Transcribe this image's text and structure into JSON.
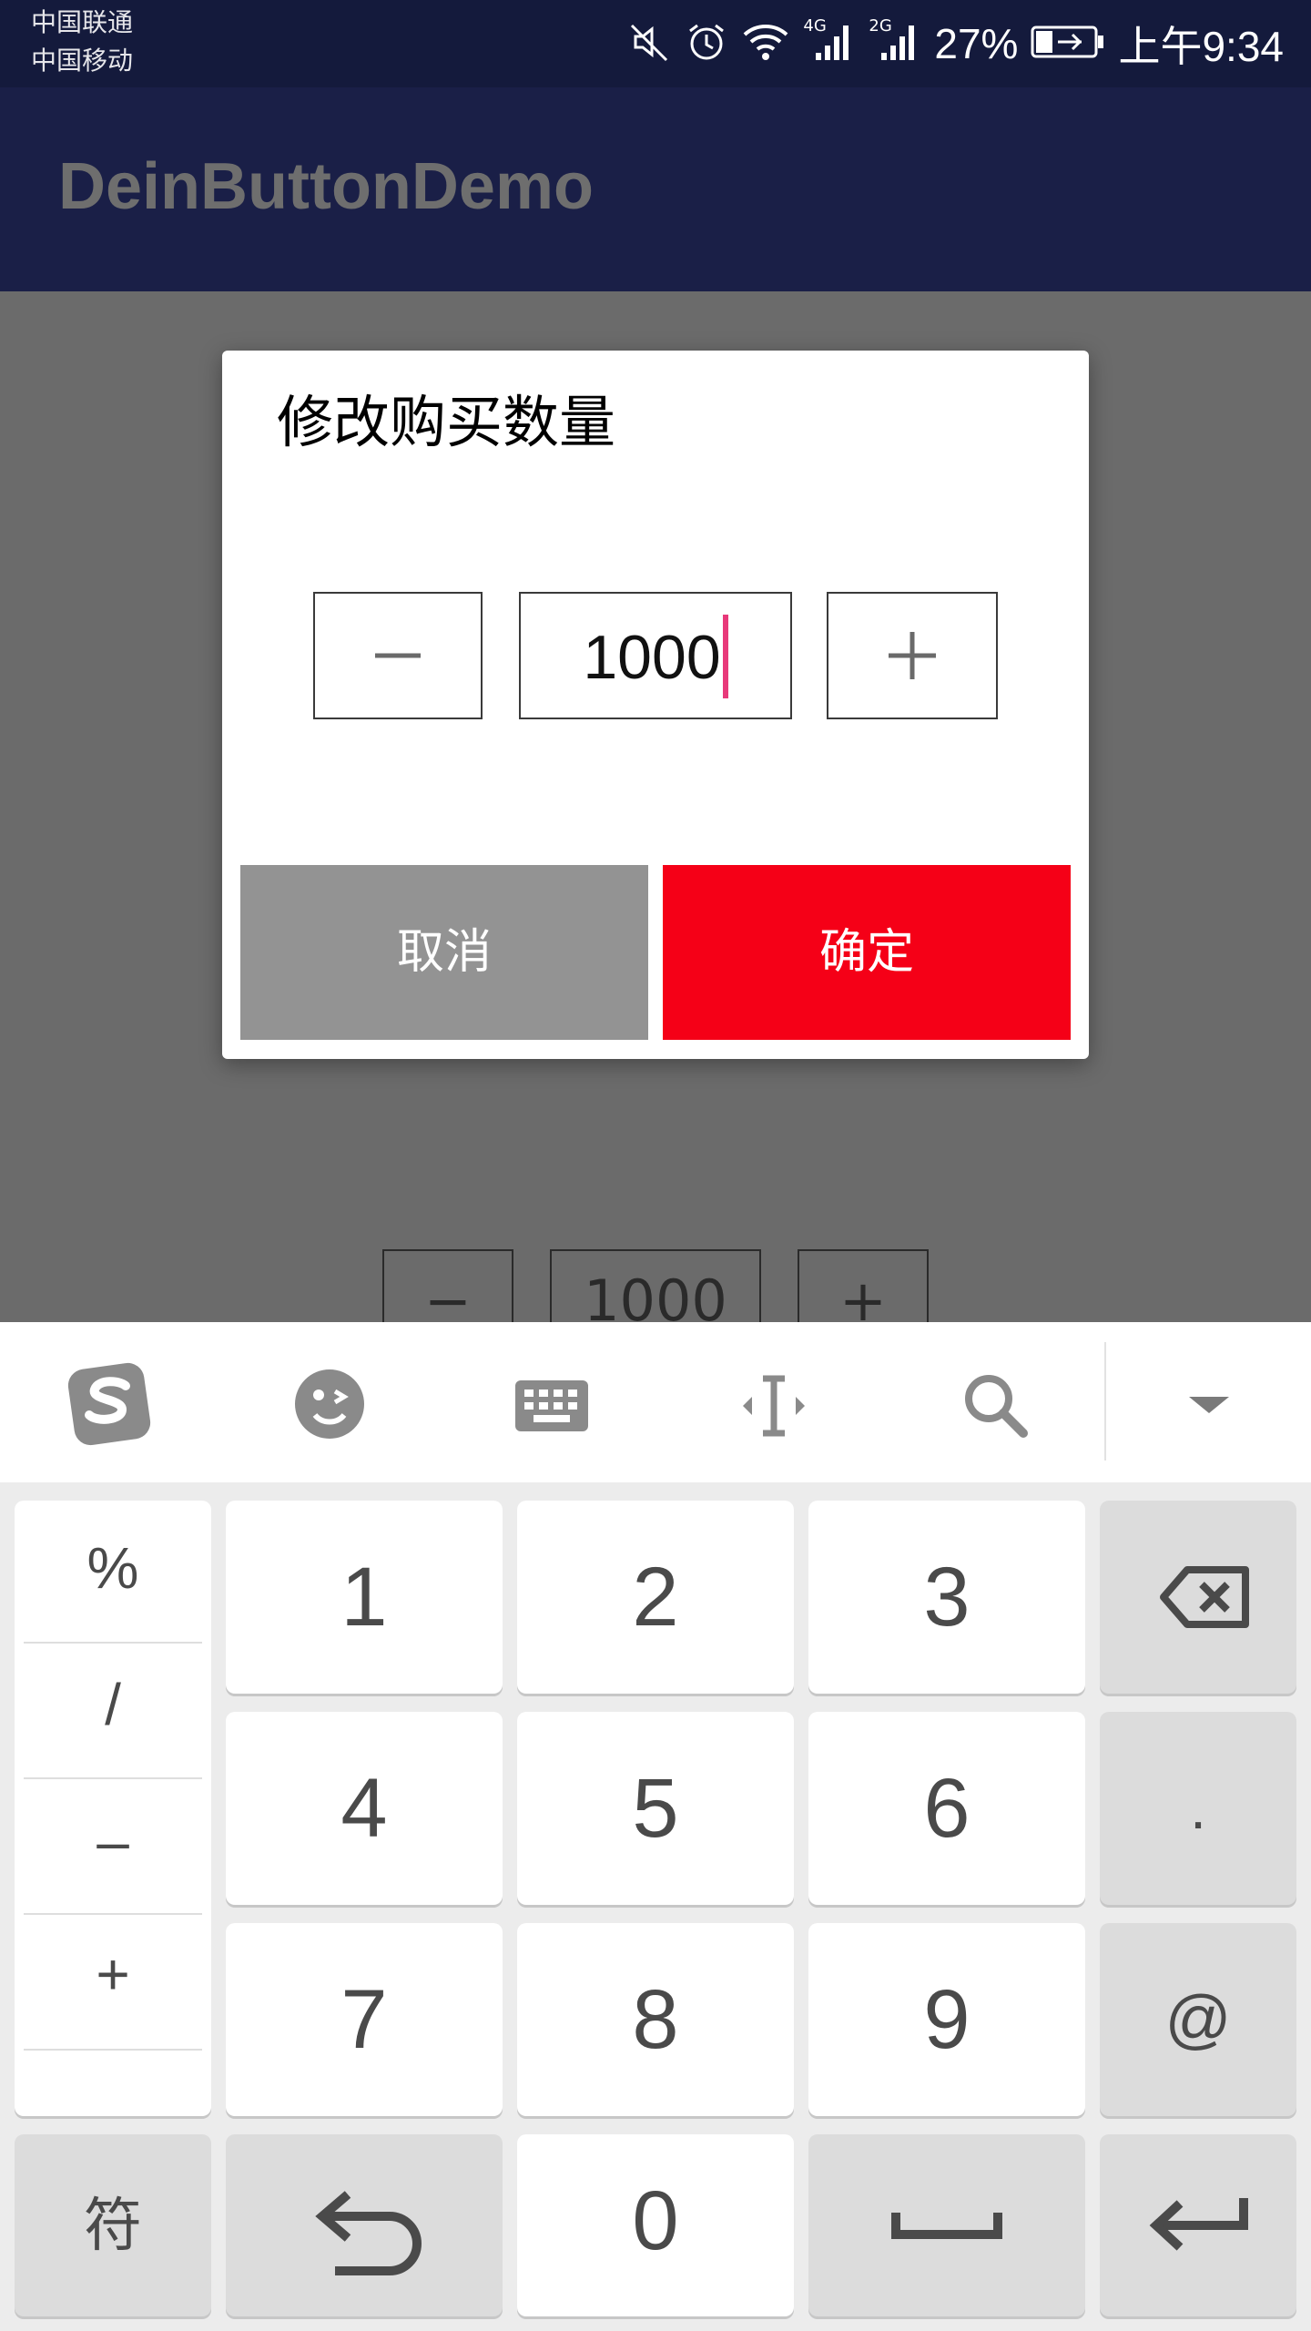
{
  "status_bar": {
    "carrier1": "中国联通",
    "carrier2": "中国移动",
    "net1": "4G",
    "net2": "2G",
    "battery": "27%",
    "time": "上午9:34",
    "icons": [
      "mute-icon",
      "alarm-icon",
      "wifi-icon",
      "signal-icon",
      "signal-icon",
      "battery-icon"
    ]
  },
  "app_bar": {
    "title": "DeinButtonDemo"
  },
  "background": {
    "minus": "−",
    "value": "1000",
    "plus": "+"
  },
  "dialog": {
    "title": "修改购买数量",
    "minus": "−",
    "plus": "+",
    "quantity": "1000",
    "cancel": "取消",
    "confirm": "确定",
    "colors": {
      "cancel": "#939393",
      "confirm": "#f50017",
      "caret": "#e8397a"
    }
  },
  "keyboard": {
    "toolbar": [
      "sogou-logo-icon",
      "emoji-icon",
      "keyboard-icon",
      "cursor-icon",
      "search-icon",
      "collapse-icon"
    ],
    "symbols": [
      "%",
      "/",
      "–",
      "+"
    ],
    "digits": [
      "1",
      "2",
      "3",
      "4",
      "5",
      "6",
      "7",
      "8",
      "9",
      "0"
    ],
    "dot": ".",
    "at": "@",
    "symbol_key": "符"
  }
}
